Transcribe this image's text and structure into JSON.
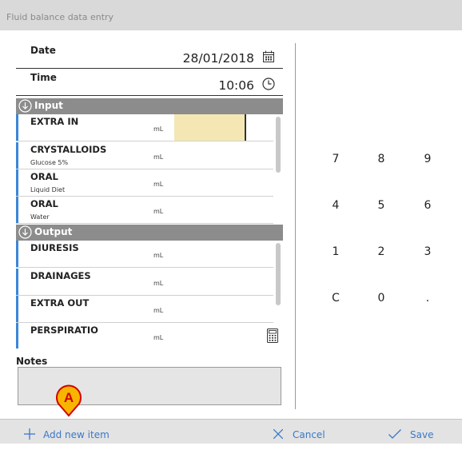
{
  "window": {
    "title": "Fluid balance data entry"
  },
  "date": {
    "label": "Date",
    "value": "28/01/2018",
    "icon": "calendar-icon"
  },
  "time": {
    "label": "Time",
    "value": "10:06",
    "icon": "clock-icon"
  },
  "input_section": {
    "title": "Input",
    "items": [
      {
        "name": "EXTRA IN",
        "sub": "",
        "unit": "mL",
        "value": ""
      },
      {
        "name": "CRYSTALLOIDS",
        "sub": "Glucose 5%",
        "unit": "mL",
        "value": ""
      },
      {
        "name": "ORAL",
        "sub": "Liquid Diet",
        "unit": "mL",
        "value": ""
      },
      {
        "name": "ORAL",
        "sub": "Water",
        "unit": "mL",
        "value": ""
      }
    ]
  },
  "output_section": {
    "title": "Output",
    "items": [
      {
        "name": "DIURESIS",
        "sub": "",
        "unit": "mL",
        "value": ""
      },
      {
        "name": "DRAINAGES",
        "sub": "",
        "unit": "mL",
        "value": ""
      },
      {
        "name": "EXTRA OUT",
        "sub": "",
        "unit": "mL",
        "value": ""
      },
      {
        "name": "PERSPIRATIO",
        "sub": "",
        "unit": "mL",
        "value": ""
      }
    ]
  },
  "notes": {
    "label": "Notes",
    "value": ""
  },
  "keypad": {
    "keys": [
      [
        "7",
        "8",
        "9"
      ],
      [
        "4",
        "5",
        "6"
      ],
      [
        "1",
        "2",
        "3"
      ],
      [
        "C",
        "0",
        "."
      ]
    ]
  },
  "footer": {
    "add_label": "Add new item",
    "cancel_label": "Cancel",
    "save_label": "Save"
  },
  "marker": {
    "label": "A"
  },
  "colors": {
    "accent": "#3a78c9",
    "row_bar": "#3a86d8",
    "active_input": "#f4e7b3",
    "section_header": "#8c8c8c",
    "marker_fill": "#f7b500",
    "marker_border": "#d40000"
  }
}
